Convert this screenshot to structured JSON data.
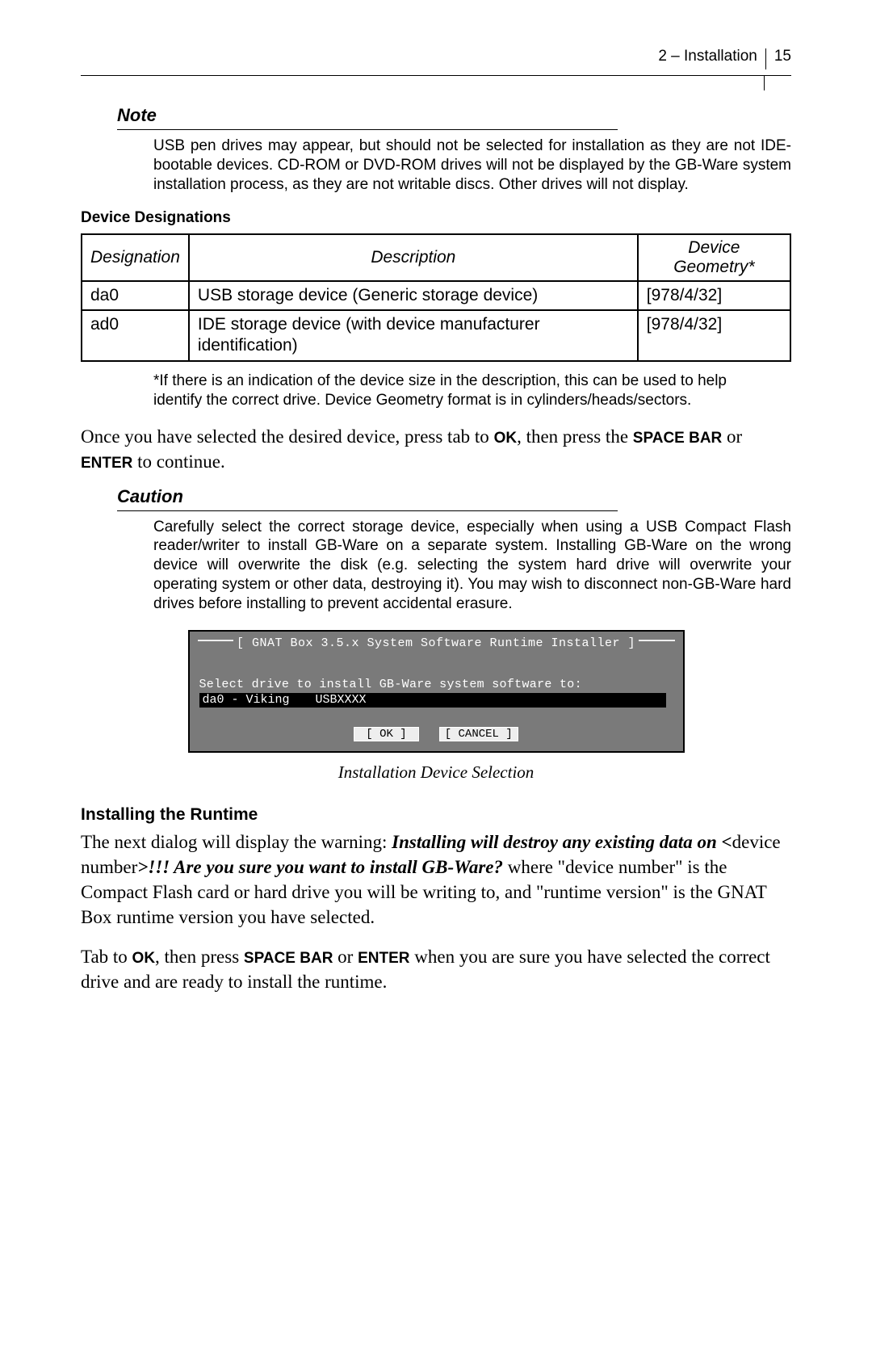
{
  "header": {
    "chapter": "2 – Installation",
    "page": "15"
  },
  "note": {
    "heading": "Note",
    "body": "USB pen drives may appear, but should not be selected for installation as they are not IDE-bootable devices. CD-ROM or DVD-ROM drives will not be displayed by the GB-Ware system installation process, as they are not writable discs. Other drives will not display."
  },
  "device_section": {
    "label": "Device Designations",
    "columns": [
      "Designation",
      "Description",
      "Device Geometry*"
    ],
    "rows": [
      {
        "designation": "da0",
        "description": "USB storage device (Generic storage device)",
        "geometry": "[978/4/32]"
      },
      {
        "designation": "ad0",
        "description": "IDE storage device (with device manufacturer identification)",
        "geometry": "[978/4/32]"
      }
    ],
    "footnote": "*If there is an indication of the device size in the description, this can be used to help identify the correct drive. Device Geometry format is in cylinders/heads/sectors."
  },
  "para1": {
    "lead": "Once you have selected the desired device, press tab to ",
    "ok": "OK",
    "mid": ", then press the ",
    "space": "SPACE BAR",
    "or": " or ",
    "enter": "ENTER",
    "tail": " to continue."
  },
  "caution": {
    "heading": "Caution",
    "body": "Carefully select the correct storage device, especially when using a USB Compact Flash reader/writer to install GB-Ware on a separate system. Installing GB-Ware on the wrong device will overwrite the disk (e.g. selecting the system hard drive will overwrite your operating system or other data, destroying it). You may wish to disconnect non-GB-Ware hard drives before installing to prevent accidental erasure."
  },
  "terminal": {
    "title": "GNAT Box 3.5.x System Software Runtime Installer",
    "prompt": "Select drive to install GB-Ware system software to:",
    "input_left": "da0 - Viking",
    "input_right": "USBXXXX",
    "ok": "OK",
    "cancel": "CANCEL",
    "caption": "Installation Device Selection"
  },
  "runtime": {
    "heading": "Installing the Runtime",
    "p1_a": "The next dialog will display the warning: ",
    "p1_b": "Installing will destroy any existing data on <",
    "p1_c": "device number",
    "p1_d": ">!!! Are you sure you want to install GB-Ware?",
    "p1_e": " where \"device number\" is the Compact Flash card or hard drive you will be writing to, and \"runtime version\" is the GNAT Box runtime version you have selected.",
    "p2_a": "Tab to ",
    "p2_ok": "OK",
    "p2_b": ", then press ",
    "p2_space": "SPACE BAR",
    "p2_or": " or ",
    "p2_enter": "ENTER",
    "p2_c": " when you are sure you have selected the correct drive and are ready to install the runtime."
  }
}
